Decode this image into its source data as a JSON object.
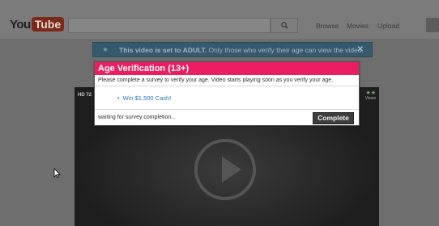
{
  "header": {
    "logo_you": "You",
    "logo_tube": "Tube",
    "search_placeholder": "",
    "nav": [
      "Browse",
      "Movies",
      "Upload"
    ]
  },
  "banner": {
    "icon": "star-icon",
    "message_bold": "This video is set to ADULT.",
    "message_rest": " Only those who verify their age can view the video.",
    "close_label": "✕"
  },
  "video": {
    "hd_label": "HD 72",
    "views_label": "Views"
  },
  "modal": {
    "title": "Age Verification (13+)",
    "subtitle": "Please complete a survey to verify your age. Video starts playing soon as you verify your age.",
    "offer": "Win $1,500 Cash!",
    "status": "waiting for survey completion...",
    "complete_label": "Complete"
  },
  "colors": {
    "modal_title_bg": "#ec1e63",
    "banner_bg": "#365a6d",
    "link": "#2175c9"
  }
}
